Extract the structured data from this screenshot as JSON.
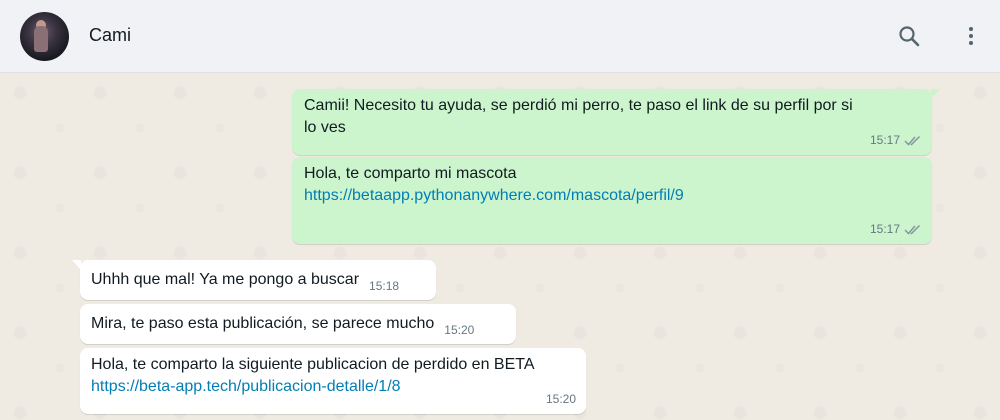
{
  "header": {
    "contact_name": "Cami",
    "icons": {
      "search": "search-icon",
      "menu": "kebab-menu-icon",
      "avatar": "contact-avatar"
    }
  },
  "colors": {
    "outgoing_bubble": "#ccf5cd",
    "incoming_bubble": "#ffffff",
    "link": "#027eb5",
    "read_ticks": "#8696a0"
  },
  "messages": [
    {
      "direction": "out",
      "lines": [
        "Camii! Necesito tu ayuda, se perdió mi perro, te paso el link de su perfil por si",
        "lo ves"
      ],
      "time": "15:17",
      "status": "read"
    },
    {
      "direction": "out",
      "text": "Hola, te comparto mi mascota",
      "link": "https://betaapp.pythonanywhere.com/mascota/perfil/9",
      "time": "15:17",
      "status": "read"
    },
    {
      "direction": "in",
      "text": "Uhhh que mal! Ya me pongo a buscar",
      "time": "15:18"
    },
    {
      "direction": "in",
      "text": "Mira, te paso esta publicación, se parece mucho",
      "time": "15:20"
    },
    {
      "direction": "in",
      "text": "Hola, te comparto la siguiente publicacion de perdido en BETA",
      "link": "https://beta-app.tech/publicacion-detalle/1/8",
      "time": "15:20"
    }
  ]
}
